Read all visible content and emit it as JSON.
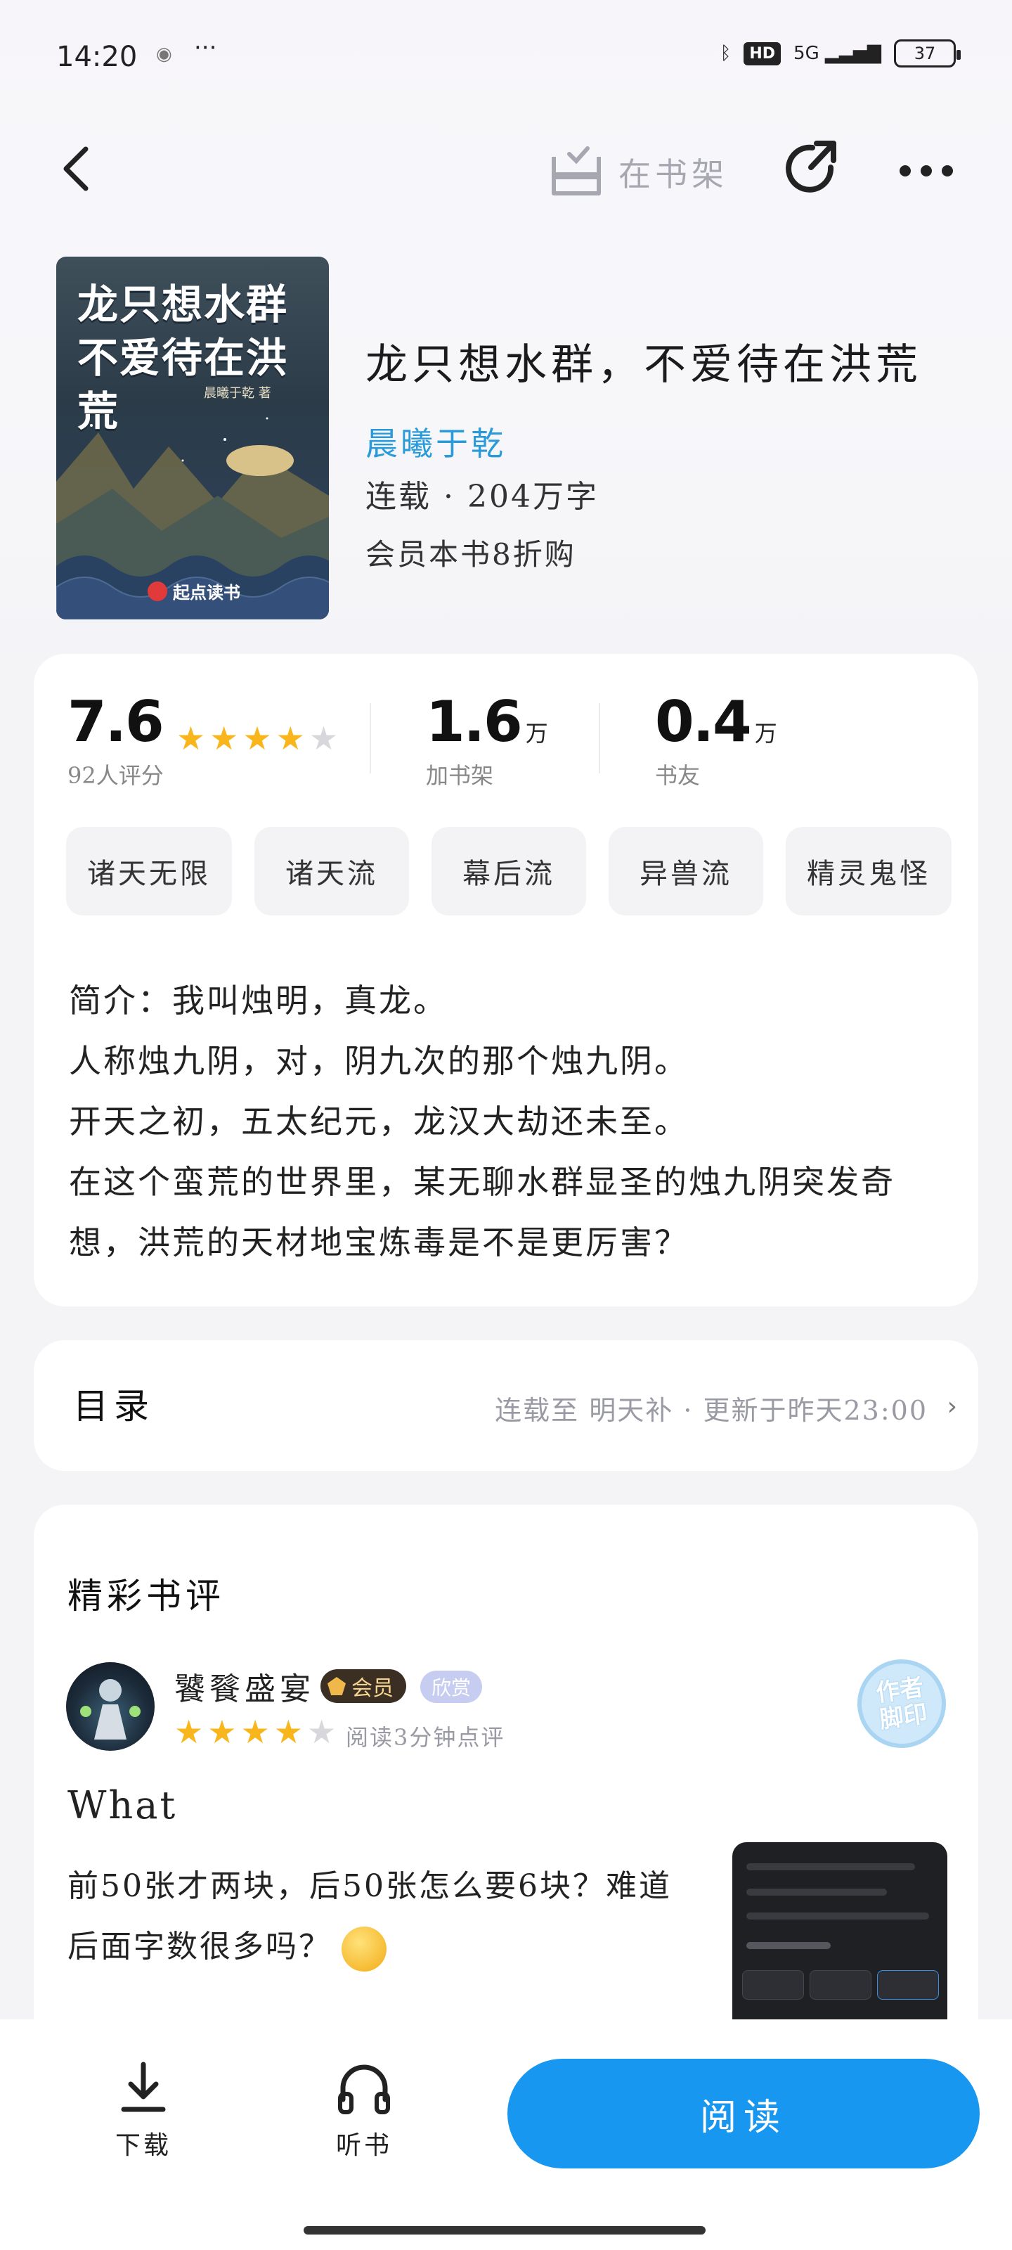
{
  "status_bar": {
    "time": "14:20",
    "menu": "···",
    "signal": "5G",
    "hd": "HD",
    "battery": "37"
  },
  "nav": {
    "shelf_label": "在书架"
  },
  "book": {
    "cover_title": "龙只想水群\n不爱待在洪荒",
    "cover_author": "晨曦于乾 著",
    "cover_brand": "起点读书",
    "title": "龙只想水群，不爱待在洪荒",
    "author": "晨曦于乾",
    "meta": "连载 · 204万字",
    "promo": "会员本书8折购"
  },
  "stats": {
    "rating": "7.6",
    "rating_count": "92人评分",
    "rating_stars": 4,
    "shelf_num": "1.6",
    "shelf_unit": "万",
    "shelf_label": "加书架",
    "friends_num": "0.4",
    "friends_unit": "万",
    "friends_label": "书友"
  },
  "tags": [
    "诸天无限",
    "诸天流",
    "幕后流",
    "异兽流",
    "精灵鬼怪"
  ],
  "intro": {
    "lines": [
      "简介：我叫烛明，真龙。",
      "人称烛九阴，对，阴九次的那个烛九阴。",
      "开天之初，五太纪元，龙汉大劫还未至。",
      "在这个蛮荒的世界里，某无聊水群显圣的烛九阴突发奇",
      "想，洪荒的天材地宝炼毒是不是更厉害？"
    ]
  },
  "toc": {
    "title": "目录",
    "status": "连载至  明天补 · 更新于昨天23:00"
  },
  "review": {
    "heading": "精彩书评",
    "reviewer": "饕餮盛宴",
    "vip": "会员",
    "level": "欣赏",
    "stars": 4,
    "note": "阅读3分钟点评",
    "stamp": "作者\n脚印",
    "title": "What",
    "body_line1": "前50张才两块，后50张怎么要6块？难道",
    "body_line2": "后面字数很多吗？"
  },
  "bottom": {
    "download": "下载",
    "listen": "听书",
    "read": "阅读"
  },
  "colors": {
    "accent": "#1797f0",
    "author_link": "#2a9bd8",
    "star": "#f8b61c"
  }
}
